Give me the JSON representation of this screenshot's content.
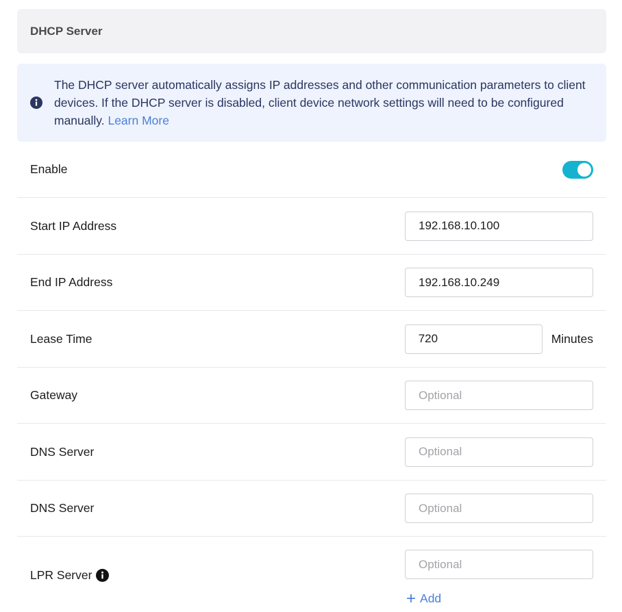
{
  "section": {
    "title": "DHCP Server"
  },
  "info": {
    "icon": "info-circle-icon",
    "text": "The DHCP server automatically assigns IP addresses and other communication parameters to client devices. If the DHCP server is disabled, client device network settings will need to be configured manually. ",
    "link_label": "Learn More"
  },
  "enable": {
    "label": "Enable",
    "state": "on",
    "accent": "#16b3d0"
  },
  "start_ip": {
    "label": "Start IP Address",
    "value": "192.168.10.100"
  },
  "end_ip": {
    "label": "End IP Address",
    "value": "192.168.10.249"
  },
  "lease": {
    "label": "Lease Time",
    "value": "720",
    "unit": "Minutes"
  },
  "gateway": {
    "label": "Gateway",
    "value": "",
    "placeholder": "Optional"
  },
  "dns1": {
    "label": "DNS Server",
    "value": "",
    "placeholder": "Optional"
  },
  "dns2": {
    "label": "DNS Server",
    "value": "",
    "placeholder": "Optional"
  },
  "lpr": {
    "label": "LPR Server",
    "value": "",
    "placeholder": "Optional",
    "icon": "info-circle-icon",
    "add_label": "Add"
  }
}
